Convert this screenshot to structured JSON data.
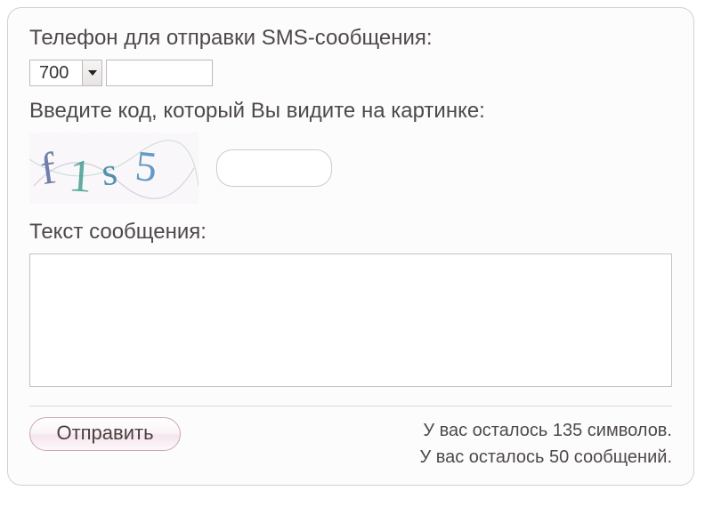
{
  "phone": {
    "label": "Телефон для отправки SMS-сообщения:",
    "prefix": "700",
    "number": ""
  },
  "captcha": {
    "label": "Введите код, который Вы видите на картинке:",
    "image_text": "f1s5",
    "value": ""
  },
  "message": {
    "label": "Текст сообщения:",
    "value": ""
  },
  "submit": {
    "label": "Отправить"
  },
  "counters": {
    "chars": "У вас осталось 135 символов.",
    "msgs": "У вас осталось 50 сообщений."
  }
}
